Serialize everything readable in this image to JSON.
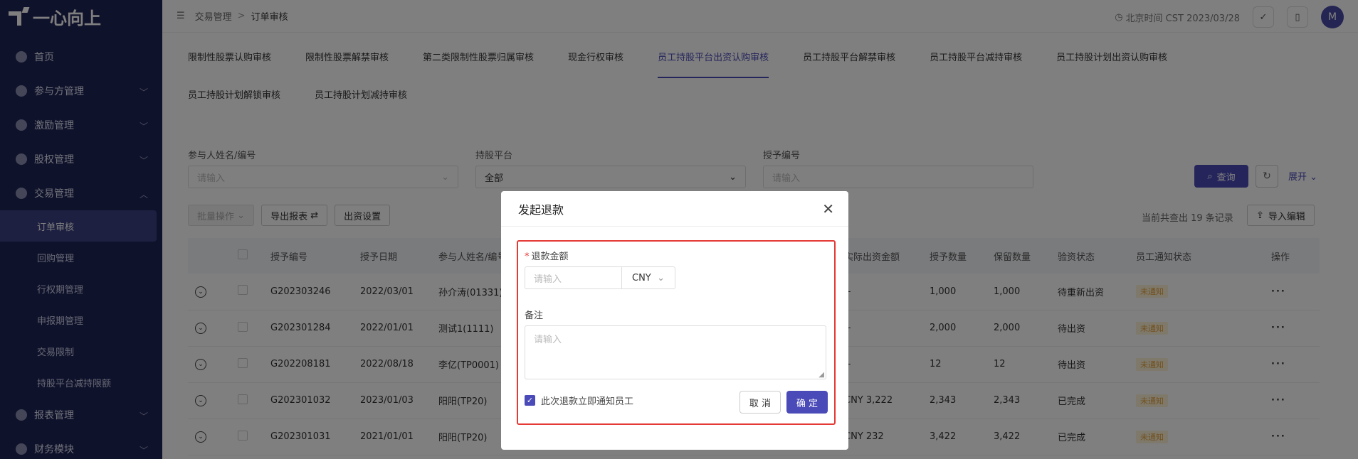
{
  "app": {
    "logo_text": "一心向上"
  },
  "sidebar": {
    "items": [
      {
        "label": "首页",
        "icon": "home-icon",
        "chevron": ""
      },
      {
        "label": "参与方管理",
        "icon": "users-icon",
        "chevron": "﹀"
      },
      {
        "label": "激励管理",
        "icon": "gift-icon",
        "chevron": "﹀"
      },
      {
        "label": "股权管理",
        "icon": "chart-icon",
        "chevron": "﹀"
      },
      {
        "label": "交易管理",
        "icon": "trade-icon",
        "chevron": "︿"
      }
    ],
    "subitems": [
      {
        "label": "订单审核",
        "active": true
      },
      {
        "label": "回购管理"
      },
      {
        "label": "行权期管理"
      },
      {
        "label": "申报期管理"
      },
      {
        "label": "交易限制"
      },
      {
        "label": "持股平台减持限额"
      }
    ],
    "bottom_items": [
      {
        "label": "报表管理",
        "icon": "report-icon",
        "chevron": "﹀"
      },
      {
        "label": "财务模块",
        "icon": "finance-icon",
        "chevron": "﹀"
      }
    ]
  },
  "topbar": {
    "breadcrumb_parent": "交易管理",
    "breadcrumb_sep": ">",
    "breadcrumb_current": "订单审核",
    "time_text": "北京时间 CST 2023/03/28",
    "avatar_letter": "M"
  },
  "tabs": {
    "row1": [
      "限制性股票认购审核",
      "限制性股票解禁审核",
      "第二类限制性股票归属审核",
      "现金行权审核",
      "员工持股平台出资认购审核",
      "员工持股平台解禁审核",
      "员工持股平台减持审核",
      "员工持股计划出资认购审核"
    ],
    "row2": [
      "员工持股计划解锁审核",
      "员工持股计划减持审核"
    ],
    "active": "员工持股平台出资认购审核"
  },
  "filters": {
    "participant_label": "参与人姓名/编号",
    "participant_placeholder": "请输入",
    "platform_label": "持股平台",
    "platform_value": "全部",
    "grant_label": "授予编号",
    "grant_placeholder": "请输入",
    "query_label": "查询",
    "expand_label": "展开"
  },
  "actions": {
    "batch_label": "批量操作",
    "export_label": "导出报表",
    "funding_label": "出资设置",
    "count_text": "当前共查出 19 条记录",
    "import_label": "导入编辑"
  },
  "table": {
    "headers": [
      "",
      "",
      "授予编号",
      "授予日期",
      "参与人姓名/编号",
      "实际出资金额",
      "授予数量",
      "保留数量",
      "验资状态",
      "员工通知状态",
      "操作"
    ],
    "rows": [
      {
        "id": "G202303246",
        "date": "2022/03/01",
        "name": "孙介涛(01331)",
        "amount": "--",
        "qty": "1,000",
        "kept": "1,000",
        "status": "待重新出资",
        "notify": "未通知"
      },
      {
        "id": "G202301284",
        "date": "2022/01/01",
        "name": "测试1(1111)",
        "amount": "--",
        "qty": "2,000",
        "kept": "2,000",
        "status": "待出资",
        "notify": "未通知"
      },
      {
        "id": "G202208181",
        "date": "2022/08/18",
        "name": "李亿(TP0001)",
        "amount": "--",
        "qty": "12",
        "kept": "12",
        "status": "待出资",
        "notify": "未通知"
      },
      {
        "id": "G202301032",
        "date": "2023/01/03",
        "name": "阳阳(TP20)",
        "amount": "CNY 3,222",
        "qty": "2,343",
        "kept": "2,343",
        "status": "已完成",
        "notify": "未通知"
      },
      {
        "id": "G202301031",
        "date": "2021/01/01",
        "name": "阳阳(TP20)",
        "amount": "CNY 232",
        "qty": "3,422",
        "kept": "3,422",
        "status": "已完成",
        "notify": "未通知"
      }
    ]
  },
  "modal": {
    "title": "发起退款",
    "amount_label": "退款金额",
    "amount_placeholder": "请输入",
    "currency": "CNY",
    "remark_label": "备注",
    "remark_placeholder": "请输入",
    "notify_label": "此次退款立即通知员工",
    "notify_checked": true,
    "cancel_label": "取 消",
    "ok_label": "确 定"
  },
  "colors": {
    "sidebar_bg": "#1e2456",
    "accent": "#4a4ab8",
    "highlight_border": "#e53935"
  }
}
